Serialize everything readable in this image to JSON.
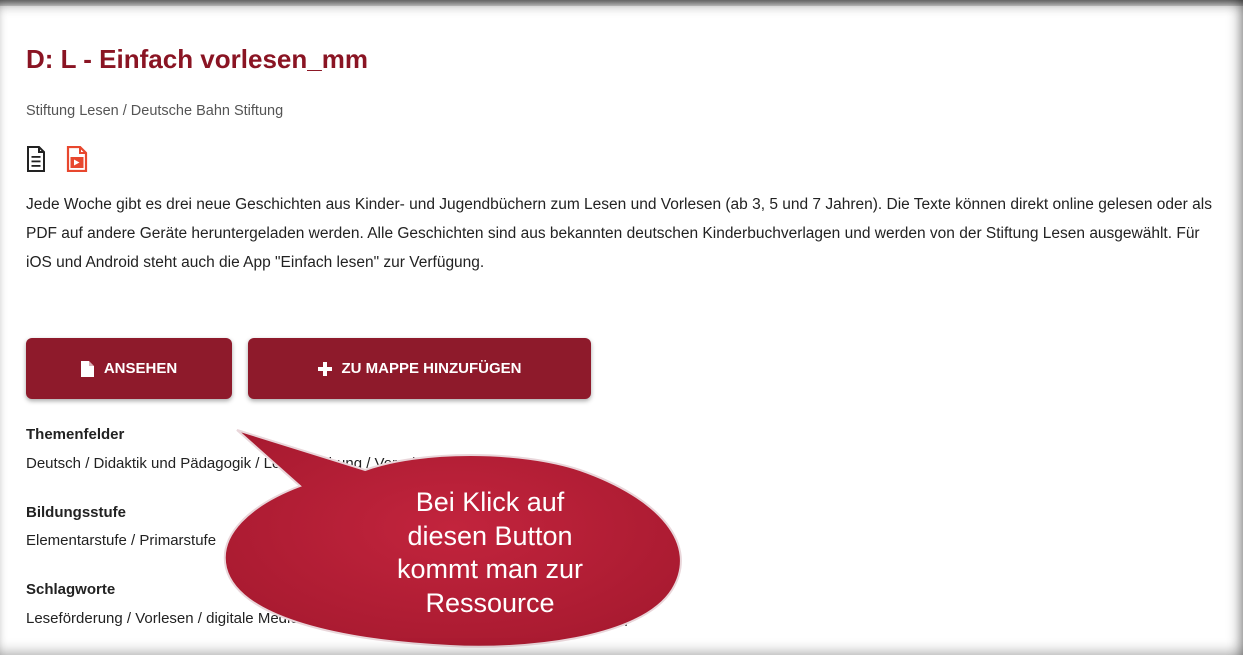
{
  "resource": {
    "title": "D: L - Einfach vorlesen_mm",
    "publisher": "Stiftung Lesen / Deutsche Bahn Stiftung",
    "type_icons": [
      "document-icon",
      "video-icon"
    ],
    "description": "Jede Woche gibt es drei neue Geschichten aus Kinder- und Jugendbüchern zum Lesen und Vorlesen (ab 3, 5 und 7 Jahren). Die Texte können direkt online gelesen oder als PDF auf andere Geräte heruntergeladen werden. Alle Geschichten sind aus bekannten deutschen Kinderbuchverlagen und werden von der Stiftung Lesen ausgewählt. Für iOS und Android steht auch die App \"Einfach lesen\" zur Verfügung."
  },
  "actions": {
    "view_label": "ANSEHEN",
    "add_label": "ZU MAPPE HINZUFÜGEN"
  },
  "meta": {
    "topics_heading": "Themenfelder",
    "topics_value": "Deutsch / Didaktik und Pädagogik / Leseerziehung / Vorschulstufe",
    "level_heading": "Bildungsstufe",
    "level_value": "Elementarstufe / Primarstufe",
    "keywords_heading": "Schlagworte",
    "keywords_value": "Leseförderung / Vorlesen / digitale Medien / Geschichten / Internet / Webseite / Lesen / App"
  },
  "callout": {
    "lines": [
      "Bei Klick auf",
      "diesen Button",
      "kommt man zur",
      "Ressource"
    ]
  },
  "colors": {
    "accent": "#8e1a2b",
    "title": "#8a1423",
    "document_icon": "#222222",
    "video_icon": "#e8472e",
    "callout_fill": "#b01e35"
  }
}
